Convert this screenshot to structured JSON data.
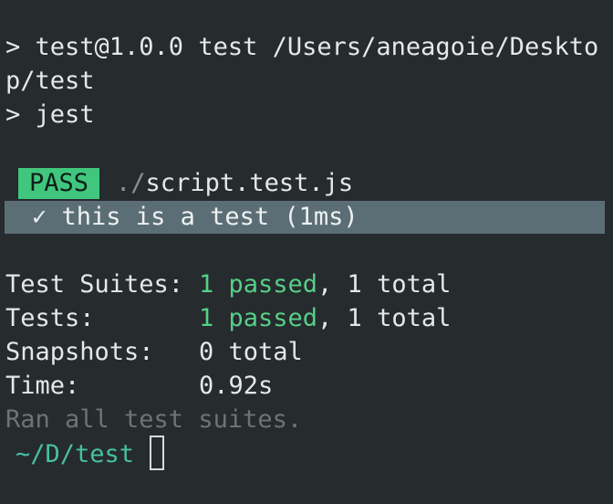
{
  "terminal": {
    "line1": "> test@1.0.0 test /Users/aneagoie/Deskto",
    "line2": "p/test",
    "line3": "> jest",
    "pass_badge": "PASS",
    "file_dir": "./",
    "file_name": "script.test.js",
    "test_check": "✓",
    "test_name": "this is a test (1ms)",
    "summary": {
      "suites_label": "Test Suites:",
      "suites_passed": "1 passed",
      "suites_total": ", 1 total",
      "tests_label": "Tests:",
      "tests_passed": "1 passed",
      "tests_total": ", 1 total",
      "snapshots_label": "Snapshots:",
      "snapshots_value": "0 total",
      "time_label": "Time:",
      "time_value": "0.92s"
    },
    "ran_all": "Ran all test suites.",
    "prompt_path": "~/D/test"
  },
  "colors": {
    "background": "#262b2e",
    "pass_badge": "#40c77d",
    "highlight_row": "#5c6e75",
    "green_text": "#56cf87",
    "prompt_path": "#47c0a3"
  }
}
